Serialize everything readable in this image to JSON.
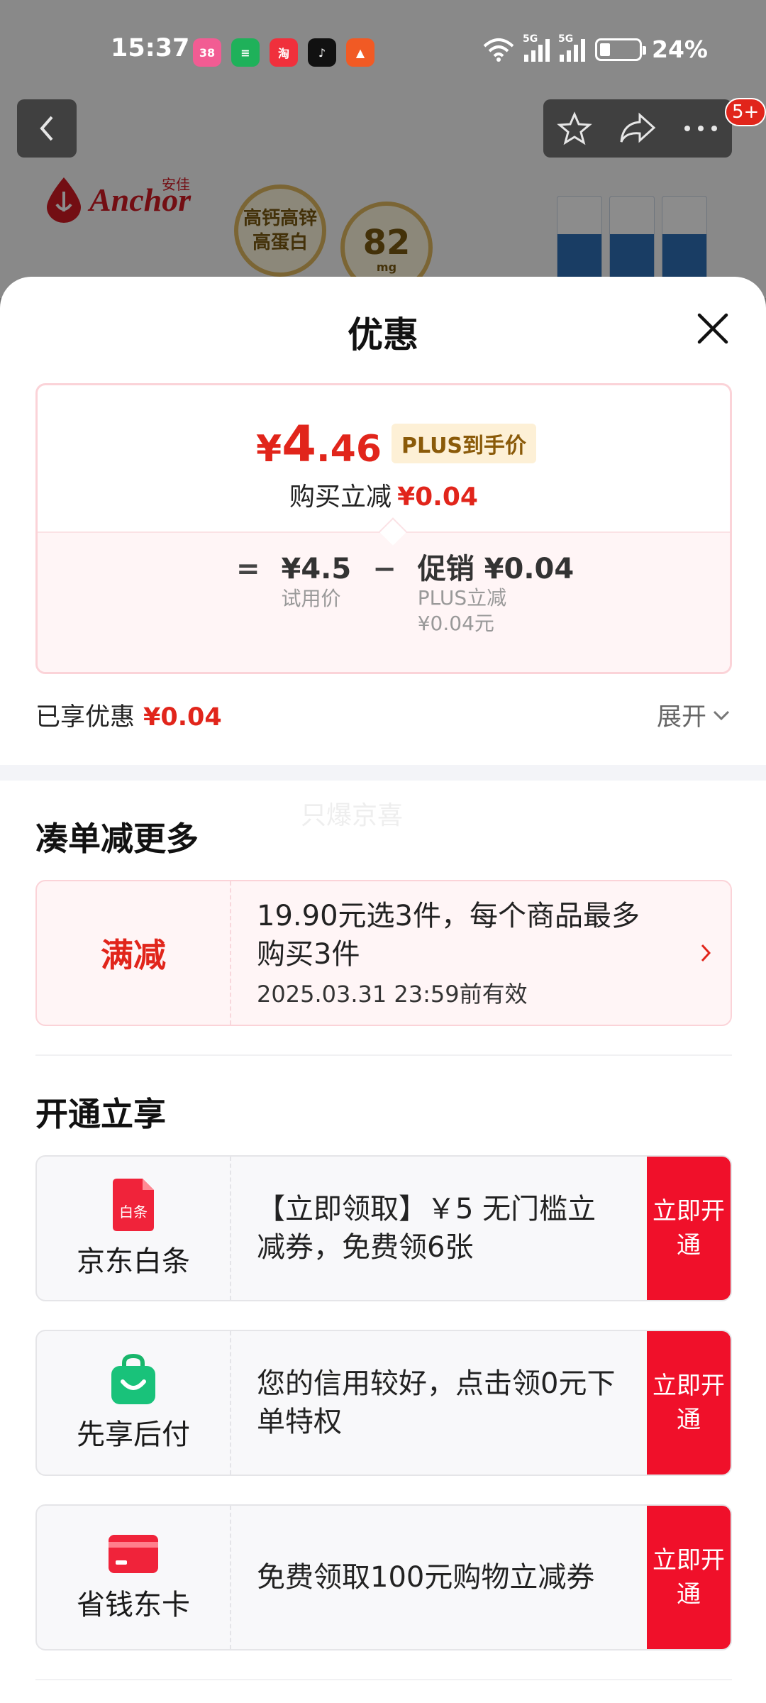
{
  "status_bar": {
    "time": "15:37",
    "apps": [
      {
        "name": "app-pink-icon",
        "label": "38",
        "color": "#f25c93"
      },
      {
        "name": "app-green-icon",
        "label": "≡",
        "color": "#1fb15a"
      },
      {
        "name": "taobao-icon",
        "label": "淘",
        "color": "#f0303c"
      },
      {
        "name": "tiktok-icon",
        "label": "♪",
        "color": "#111111"
      },
      {
        "name": "app-orange-icon",
        "label": "▲",
        "color": "#f15a24"
      }
    ],
    "net_1": "5G",
    "net_2": "5G",
    "battery": "24%",
    "battery_level": 0.24
  },
  "background": {
    "badge": "5+",
    "brand_name": "Anchor",
    "brand_cn": "安佳",
    "promo_1": "高钙高锌高蛋白",
    "promo_2_value": "82",
    "promo_2_unit": "mg"
  },
  "sheet": {
    "title": "优惠",
    "price_card": {
      "currency": "¥",
      "price_int": "4",
      "price_dec": ".46",
      "plus_tag": "PLUS到手价",
      "save_label": "购买立减",
      "save_value": "¥0.04",
      "eq": "=",
      "minus": "−",
      "base_value": "¥4.5",
      "base_label": "试用价",
      "promo_value": "促销 ¥0.04",
      "promo_sub1": "PLUS立减",
      "promo_sub2": "¥0.04元"
    },
    "enjoyed_label": "已享优惠",
    "enjoyed_value": "¥0.04",
    "expand_label": "展开",
    "watermark": "只爆京喜",
    "combine": {
      "title": "凑单减更多",
      "coupon": {
        "type": "满减",
        "desc": "19.90元选3件，每个商品最多购买3件",
        "valid": "2025.03.31 23:59前有效"
      }
    },
    "open": {
      "title": "开通立享",
      "items": [
        {
          "name": "京东白条",
          "icon_text": "白条",
          "desc": "【立即领取】￥5 无门槛立减券，免费领6张",
          "cta": "立即开通"
        },
        {
          "name": "先享后付",
          "desc": "您的信用较好，点击领0元下单特权",
          "cta": "立即开通"
        },
        {
          "name": "省钱东卡",
          "desc": "免费领取100元购物立减券",
          "cta": "立即开通"
        }
      ]
    }
  },
  "colors": {
    "accent": "#e1251b",
    "cta": "#f0102a",
    "plus_bg": "#fdf0d6",
    "card_border": "#fbd3d8"
  }
}
